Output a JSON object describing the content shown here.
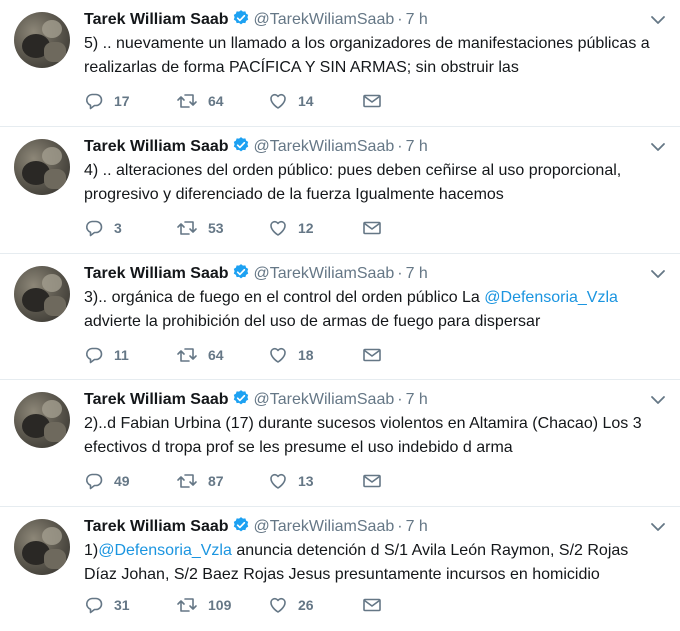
{
  "tweets": [
    {
      "name": "Tarek William Saab",
      "handle": "@TarekWiliamSaab",
      "separator": "·",
      "time": "7 h",
      "text_before": "5) .. nuevamente un llamado a los organizadores de manifestaciones públicas a realizarlas de forma PACÍFICA Y SIN ARMAS; sin obstruir las",
      "mention": "",
      "text_after": "",
      "replies": "17",
      "retweets": "64",
      "likes": "14"
    },
    {
      "name": "Tarek William Saab",
      "handle": "@TarekWiliamSaab",
      "separator": "·",
      "time": "7 h",
      "text_before": "4) .. alteraciones del orden público: pues deben ceñirse al uso proporcional, progresivo y diferenciado de la fuerza Igualmente hacemos",
      "mention": "",
      "text_after": "",
      "replies": "3",
      "retweets": "53",
      "likes": "12"
    },
    {
      "name": "Tarek William Saab",
      "handle": "@TarekWiliamSaab",
      "separator": "·",
      "time": "7 h",
      "text_before": "3).. orgánica de fuego en el control del orden público La ",
      "mention": "@Defensoria_Vzla",
      "text_after": " advierte la prohibición del uso de armas de fuego para dispersar",
      "replies": "11",
      "retweets": "64",
      "likes": "18"
    },
    {
      "name": "Tarek William Saab",
      "handle": "@TarekWiliamSaab",
      "separator": "·",
      "time": "7 h",
      "text_before": "2)..d Fabian Urbina (17) durante sucesos violentos en Altamira (Chacao) Los 3 efectivos d tropa prof se les presume el uso indebido d arma",
      "mention": "",
      "text_after": "",
      "replies": "49",
      "retweets": "87",
      "likes": "13"
    },
    {
      "name": "Tarek William Saab",
      "handle": "@TarekWiliamSaab",
      "separator": "·",
      "time": "7 h",
      "text_before": "1)",
      "mention": "@Defensoria_Vzla",
      "text_after": " anuncia detención d S/1 Avila León Raymon, S/2 Rojas Díaz Johan, S/2 Baez Rojas Jesus presuntamente incursos en homicidio",
      "replies": "31",
      "retweets": "109",
      "likes": "26"
    }
  ],
  "icons": {
    "verified_color": "#1da1f2",
    "action_color": "#657786",
    "mention_color": "#1b95e0",
    "reply": "reply-icon",
    "retweet": "retweet-icon",
    "like": "heart-icon",
    "message": "direct-message-icon",
    "more": "chevron-down-icon"
  }
}
